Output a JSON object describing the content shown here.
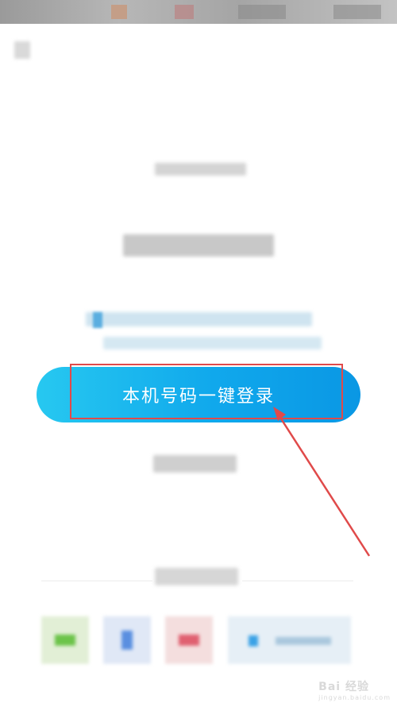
{
  "login": {
    "one_click_label": "本机号码一键登录"
  },
  "annotation": {
    "highlight_color": "#e04a4a"
  },
  "brand": {
    "button_gradient_start": "#27c8f0",
    "button_gradient_end": "#0a97e4"
  },
  "watermark": {
    "text": "Bai 经验",
    "url": "jingyan.baidu.com"
  }
}
